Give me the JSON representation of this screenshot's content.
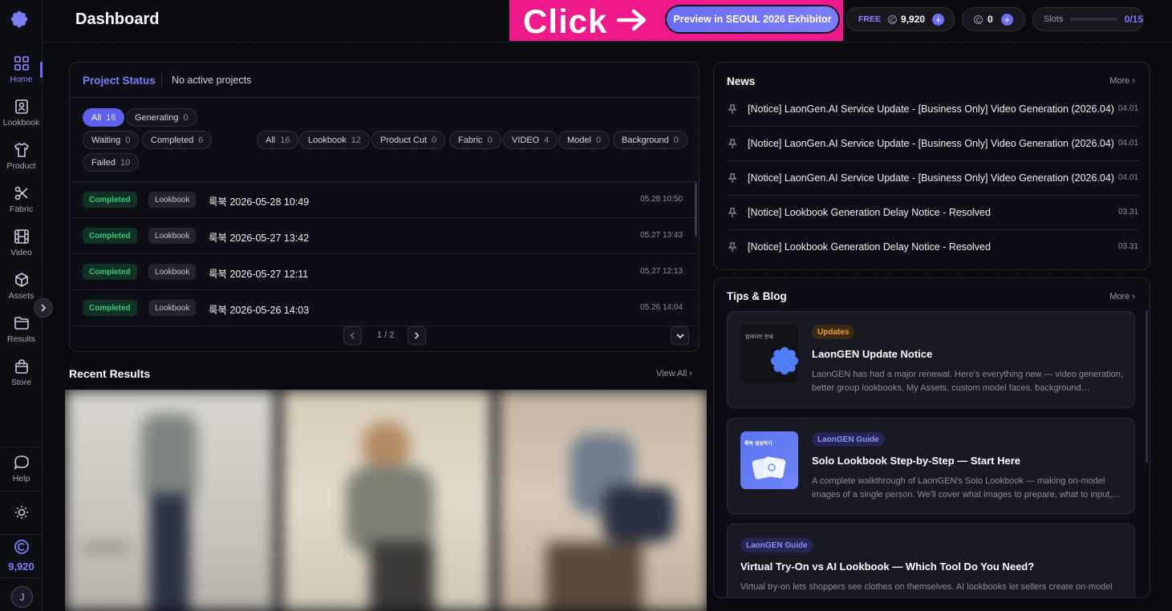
{
  "header": {
    "title": "Dashboard",
    "overlay_text": "Click",
    "preview_label": "Preview in SEOUL 2026 Exhibitor",
    "plan": "FREE",
    "credits": "9,920",
    "second_credit": "0",
    "slots_label": "Slots",
    "slots_value": "0/15"
  },
  "sidebar": {
    "items": [
      {
        "label": "Home",
        "icon": "home-grid-icon"
      },
      {
        "label": "Lookbook",
        "icon": "lookbook-icon"
      },
      {
        "label": "Product",
        "icon": "shirt-icon"
      },
      {
        "label": "Fabric",
        "icon": "scissors-icon"
      },
      {
        "label": "Video",
        "icon": "film-icon"
      },
      {
        "label": "Assets",
        "icon": "box-icon"
      },
      {
        "label": "Results",
        "icon": "folder-icon"
      },
      {
        "label": "Store",
        "icon": "bag-icon"
      }
    ],
    "help": "Help",
    "credits": "9,920",
    "avatar_initial": "J"
  },
  "project_status": {
    "title": "Project Status",
    "subtitle": "No active projects",
    "status_filters": [
      {
        "label": "All",
        "count": "16"
      },
      {
        "label": "Generating",
        "count": "0"
      },
      {
        "label": "Waiting",
        "count": "0"
      },
      {
        "label": "Completed",
        "count": "6"
      },
      {
        "label": "Failed",
        "count": "10"
      }
    ],
    "type_filters": [
      {
        "label": "All",
        "count": "16"
      },
      {
        "label": "Lookbook",
        "count": "12"
      },
      {
        "label": "Product Cut",
        "count": "0"
      },
      {
        "label": "Fabric",
        "count": "0"
      },
      {
        "label": "VIDEO",
        "count": "4"
      },
      {
        "label": "Model",
        "count": "0"
      },
      {
        "label": "Background",
        "count": "0"
      }
    ],
    "rows": [
      {
        "status": "Completed",
        "type": "Lookbook",
        "title": "룩북 2026-05-28 10:49",
        "time": "05.28 10:50"
      },
      {
        "status": "Completed",
        "type": "Lookbook",
        "title": "룩북 2026-05-27 13:42",
        "time": "05.27 13:43"
      },
      {
        "status": "Completed",
        "type": "Lookbook",
        "title": "룩북 2026-05-27 12:11",
        "time": "05.27 12:13"
      },
      {
        "status": "Completed",
        "type": "Lookbook",
        "title": "룩북 2026-05-26 14:03",
        "time": "05.26 14:04"
      }
    ],
    "page": "1 / 2"
  },
  "recent": {
    "title": "Recent Results",
    "view_all": "View All"
  },
  "news": {
    "title": "News",
    "more": "More",
    "items": [
      {
        "text": "[Notice] LaonGen.AI Service Update - [Business Only] Video Generation (2026.04)",
        "date": "04.01"
      },
      {
        "text": "[Notice] LaonGen.AI Service Update - [Business Only] Video Generation (2026.04)",
        "date": "04.01"
      },
      {
        "text": "[Notice] LaonGen.AI Service Update - [Business Only] Video Generation (2026.04)",
        "date": "04.01"
      },
      {
        "text": "[Notice] Lookbook Generation Delay Notice - Resolved",
        "date": "03.31"
      },
      {
        "text": "[Notice] Lookbook Generation Delay Notice - Resolved",
        "date": "03.31"
      }
    ]
  },
  "tips": {
    "title": "Tips & Blog",
    "more": "More",
    "posts": [
      {
        "tag": "Updates",
        "title": "LaonGEN Update Notice",
        "desc": "LaonGEN has had a major renewal. Here's everything new — video generation, better group lookbooks, My Assets, custom model faces, background…",
        "thumb_caption": "업데이트 안내"
      },
      {
        "tag": "LaonGEN Guide",
        "title": "Solo Lookbook Step-by-Step — Start Here",
        "desc": "A complete walkthrough of LaonGEN's Solo Lookbook — making on-model images of a single person. We'll cover what images to prepare, what to input,…",
        "thumb_caption": "룩북 생성하기"
      },
      {
        "tag": "LaonGEN Guide",
        "title": "Virtual Try-On vs AI Lookbook — Which Tool Do You Need?",
        "desc": "Virtual try-on lets shoppers see clothes on themselves. AI lookbooks let sellers create on-model"
      }
    ]
  },
  "colors": {
    "accent": "#6d6ff5",
    "overlay": "#ee1a8c",
    "completed": "#36c87a"
  }
}
